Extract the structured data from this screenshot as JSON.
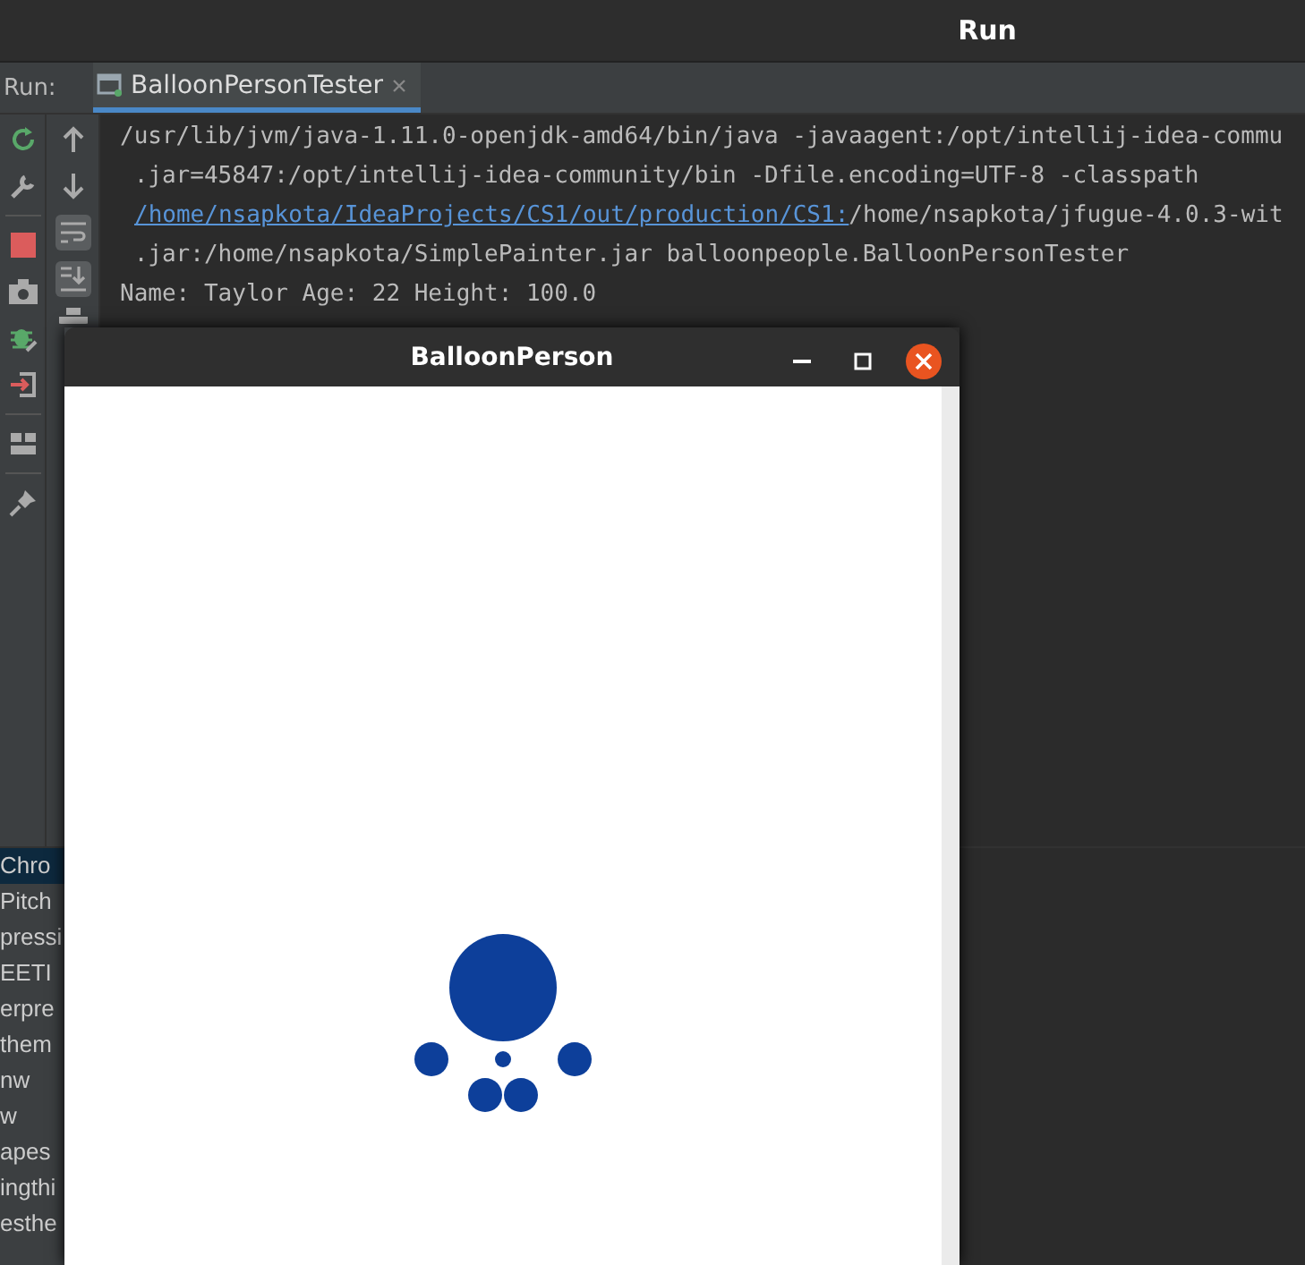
{
  "app_title": "Run",
  "run_panel": {
    "label": "Run:",
    "tabs": [
      {
        "label": "BalloonPersonTester",
        "selected": true
      }
    ],
    "soft_wrap_on": true,
    "scroll_to_end_on": true,
    "console": [
      {
        "parts": [
          {
            "kind": "text",
            "text": "/usr/lib/jvm/java-1.11.0-openjdk-amd64/bin/java -javaagent:/opt/intellij-idea-commu"
          }
        ]
      },
      {
        "parts": [
          {
            "kind": "text",
            "text": " .jar=45847:/opt/intellij-idea-community/bin -Dfile.encoding=UTF-8 -classpath"
          }
        ]
      },
      {
        "parts": [
          {
            "kind": "link",
            "text": "/home/nsapkota/IdeaProjects/CS1/out/production/CS1:"
          },
          {
            "kind": "text",
            "text": "/home/nsapkota/jfugue-4.0.3-wit"
          }
        ]
      },
      {
        "parts": [
          {
            "kind": "text",
            "text": " .jar:/home/nsapkota/SimplePainter.jar balloonpeople.BalloonPersonTester"
          }
        ]
      },
      {
        "parts": [
          {
            "kind": "text",
            "text": "Name: Taylor Age: 22 Height: 100.0"
          }
        ]
      }
    ]
  },
  "project_list": [
    {
      "label": "Chro",
      "selected": true
    },
    {
      "label": "Pitch",
      "selected": false
    },
    {
      "label": "pressi",
      "selected": false
    },
    {
      "label": "EETI",
      "selected": false
    },
    {
      "label": "erpre",
      "selected": false
    },
    {
      "label": "them",
      "selected": false
    },
    {
      "label": "nw",
      "selected": false
    },
    {
      "label": "w",
      "selected": false
    },
    {
      "label": "apes",
      "selected": false
    },
    {
      "label": "ingthi",
      "selected": false
    },
    {
      "label": "esthe",
      "selected": false
    }
  ],
  "java_window": {
    "title": "BalloonPerson"
  }
}
